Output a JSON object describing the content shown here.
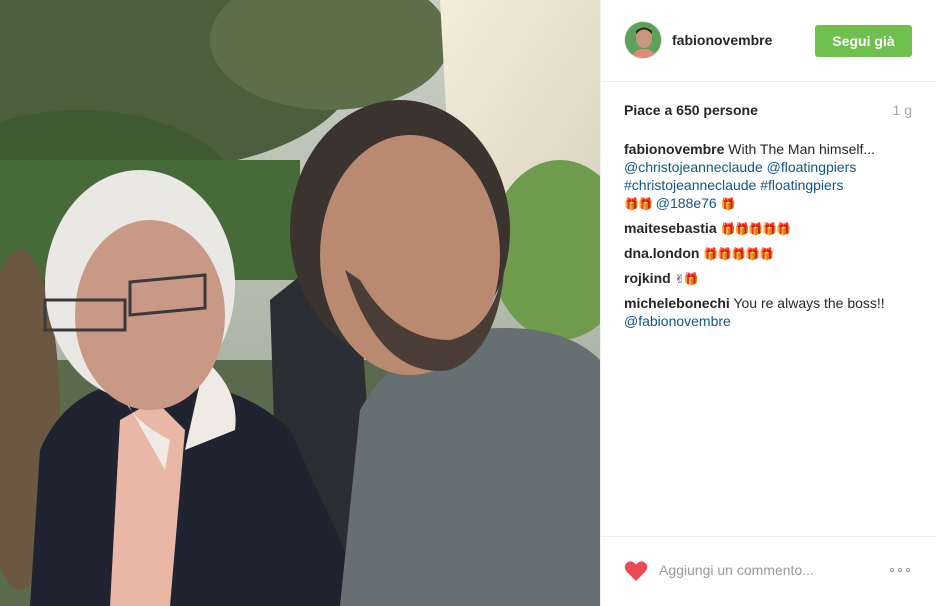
{
  "post": {
    "username": "fabionovembre",
    "follow_label": "Segui già",
    "likes": "Piace a 650 persone",
    "time": "1 g"
  },
  "comments": [
    {
      "user": "fabionovembre",
      "text": "With The Man himself...",
      "mention1": "@christojeanneclaude",
      "mention2": "@floatingpiers",
      "tag1": "#christojeanneclaude",
      "tag2": "#floatingpiers",
      "emoji1": "🎁🎁",
      "mention3": "@188e76",
      "emoji2": "🎁"
    },
    {
      "user": "maitesebastia",
      "text": "🎁🎁🎁🎁🎁"
    },
    {
      "user": "dna.london",
      "text": "🎁🎁🎁🎁🎁"
    },
    {
      "user": "rojkind",
      "text": "✌🎁"
    },
    {
      "user": "michelebonechi",
      "text": "You re always the boss!!",
      "mention": "@fabionovembre"
    }
  ],
  "comment_box": {
    "placeholder": "Aggiungi un commento..."
  },
  "colors": {
    "follow": "#70c050",
    "link": "#125688",
    "heart": "#ed4956",
    "muted": "#a5a7aa"
  },
  "icons": {
    "like": "heart-icon",
    "options": "more-options-icon"
  }
}
